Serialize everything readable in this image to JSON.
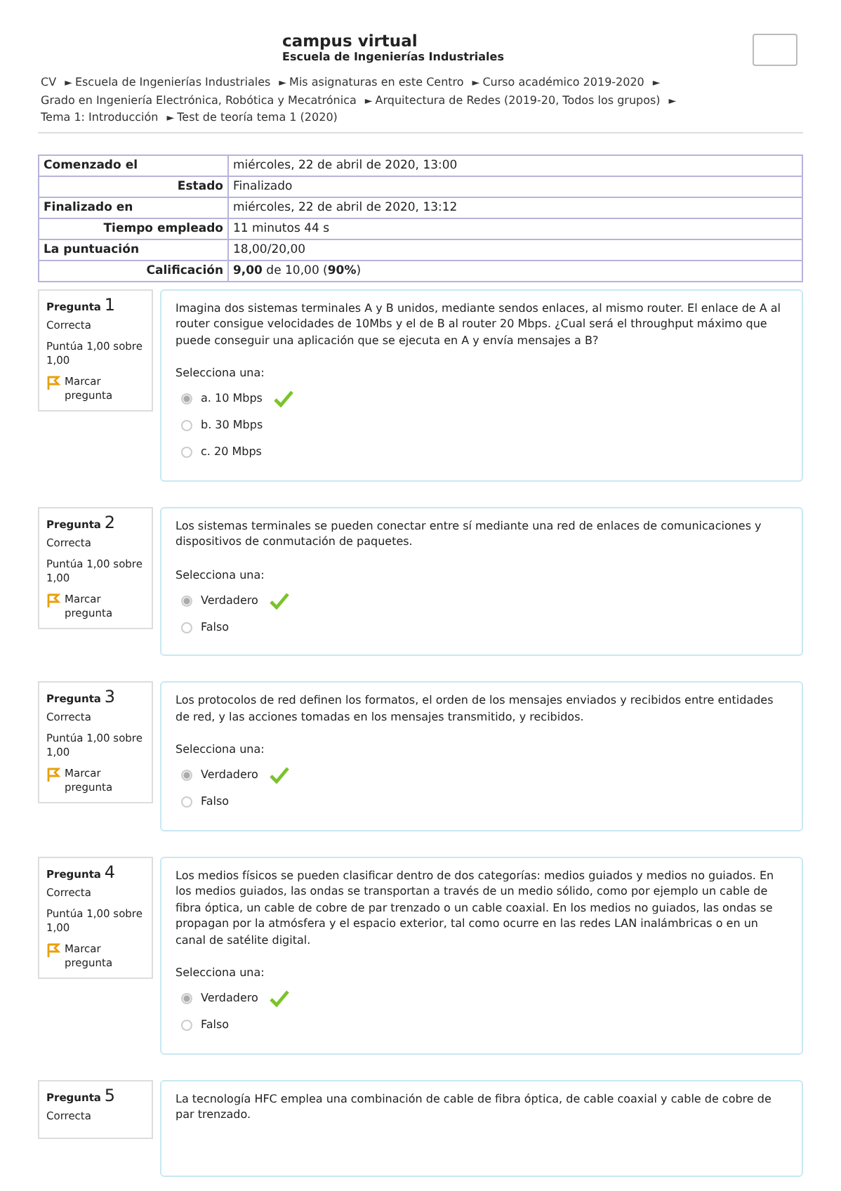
{
  "header": {
    "title": "campus virtual",
    "subtitle": "Escuela de Ingenierías Industriales"
  },
  "breadcrumb": [
    {
      "label": "CV"
    },
    {
      "label": "Escuela de Ingenierías Industriales",
      "arrow": "►"
    },
    {
      "label": "Mis asignaturas en este Centro",
      "arrow": "►"
    },
    {
      "label": "Curso académico 2019-2020",
      "arrow": "►"
    },
    {
      "label": "Grado en Ingeniería Electrónica, Robótica y Mecatrónica",
      "arrow": "►"
    },
    {
      "label": "Arquitectura de Redes (2019-20, Todos los grupos)",
      "arrow": "►"
    },
    {
      "label": "Tema 1: Introducción",
      "arrow": "►"
    },
    {
      "label": "Test de teoría tema 1 (2020)",
      "arrow": "►"
    }
  ],
  "summary": [
    {
      "label": "Comenzado el",
      "value": "miércoles, 22 de abril de 2020, 13:00"
    },
    {
      "label": "Estado",
      "value": "Finalizado"
    },
    {
      "label": "Finalizado en",
      "value": "miércoles, 22 de abril de 2020, 13:12"
    },
    {
      "label": "Tiempo empleado",
      "value": "11 minutos 44 s"
    },
    {
      "label": "La puntuación",
      "value": "18,00/20,00"
    },
    {
      "label": "Calificación",
      "value": "**9,00** de 10,00 (**90%**)"
    }
  ],
  "questions": [
    {
      "word": "Pregunta",
      "number": "1",
      "state": "Correcta",
      "grade": "Puntúa 1,00 sobre 1,00",
      "flag": "Marcar pregunta",
      "text": "Imagina dos sistemas terminales A y B unidos, mediante sendos enlaces, al mismo router. El enlace de A al router consigue velocidades de 10Mbs y el de B al router 20 Mbps. ¿Cual será el throughput máximo que puede conseguir una aplicación que se ejecuta en A y envía mensajes a B?",
      "prompt": "Selecciona una:",
      "options": [
        {
          "label": "a. 10 Mbps",
          "selected": true,
          "correct": true
        },
        {
          "label": "b. 30 Mbps",
          "selected": false,
          "correct": false
        },
        {
          "label": "c. 20 Mbps",
          "selected": false,
          "correct": false
        }
      ]
    },
    {
      "word": "Pregunta",
      "number": "2",
      "state": "Correcta",
      "grade": "Puntúa 1,00 sobre 1,00",
      "flag": "Marcar pregunta",
      "text": "Los sistemas terminales se pueden conectar entre sí mediante una red de enlaces de comunicaciones y dispositivos de conmutación de paquetes.",
      "prompt": "Selecciona una:",
      "options": [
        {
          "label": "Verdadero",
          "selected": true,
          "correct": true
        },
        {
          "label": "Falso",
          "selected": false,
          "correct": false
        }
      ]
    },
    {
      "word": "Pregunta",
      "number": "3",
      "state": "Correcta",
      "grade": "Puntúa 1,00 sobre 1,00",
      "flag": "Marcar pregunta",
      "text": "Los protocolos de red definen los formatos, el orden de los mensajes enviados y recibidos entre entidades de red, y las acciones tomadas en los mensajes transmitido, y recibidos.",
      "prompt": "Selecciona una:",
      "options": [
        {
          "label": "Verdadero",
          "selected": true,
          "correct": true
        },
        {
          "label": "Falso",
          "selected": false,
          "correct": false
        }
      ]
    },
    {
      "word": "Pregunta",
      "number": "4",
      "state": "Correcta",
      "grade": "Puntúa 1,00 sobre 1,00",
      "flag": "Marcar pregunta",
      "text": "Los medios físicos se pueden clasificar dentro de dos categorías: medios guiados y medios no guiados. En los medios guiados, las ondas se transportan a través de un medio sólido, como por ejemplo un cable de fibra óptica, un cable de cobre de par trenzado o un cable coaxial. En los medios no guiados, las ondas se propagan por la atmósfera y el espacio exterior, tal como ocurre en las redes LAN inalámbricas o en un canal de satélite digital.",
      "prompt": "Selecciona una:",
      "options": [
        {
          "label": "Verdadero",
          "selected": true,
          "correct": true
        },
        {
          "label": "Falso",
          "selected": false,
          "correct": false
        }
      ]
    },
    {
      "word": "Pregunta",
      "number": "5",
      "state": "Correcta",
      "text": "La tecnología HFC emplea una combinación de cable de fibra óptica, de cable coaxial y cable de cobre de par trenzado."
    }
  ]
}
